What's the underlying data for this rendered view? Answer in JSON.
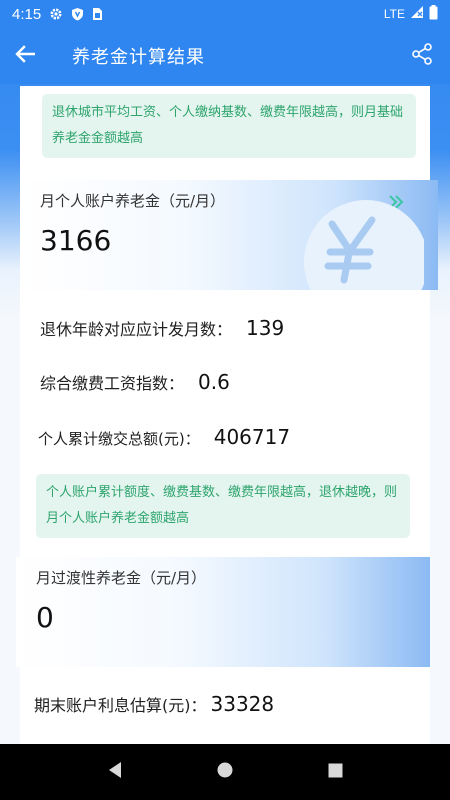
{
  "status": {
    "time": "4:15",
    "network": "LTE"
  },
  "header": {
    "title": "养老金计算结果"
  },
  "tips": {
    "tip1": "退休城市平均工资、个人缴纳基数、缴费年限越高，则月基础养老金金额越高",
    "tip2": "个人账户累计额度、缴费基数、缴费年限越高，退休越晚，则月个人账户养老金额越高"
  },
  "personal_pension": {
    "label": "月个人账户养老金（元/月）",
    "value": "3166"
  },
  "rows": {
    "months_label": "退休年龄对应应计发月数：",
    "months_value": "139",
    "index_label": "综合缴费工资指数：",
    "index_value": "0.6",
    "total_label": "个人累计缴交总额(元)：",
    "total_value": "406717",
    "interest_label": "期末账户利息估算(元)：",
    "interest_value": "33328"
  },
  "transition_pension": {
    "label": "月过渡性养老金（元/月）",
    "value": "0"
  },
  "colors": {
    "primary": "#2f86f0",
    "tip_bg": "#e3f5ee",
    "tip_text": "#2fa46e"
  },
  "icons": [
    "gear-icon",
    "shield-icon",
    "sim-icon",
    "signal-icon",
    "battery-icon",
    "back-arrow-icon",
    "share-icon",
    "yen-coin-icon",
    "double-chevron-icon",
    "nav-back-icon",
    "nav-home-icon",
    "nav-recents-icon"
  ]
}
